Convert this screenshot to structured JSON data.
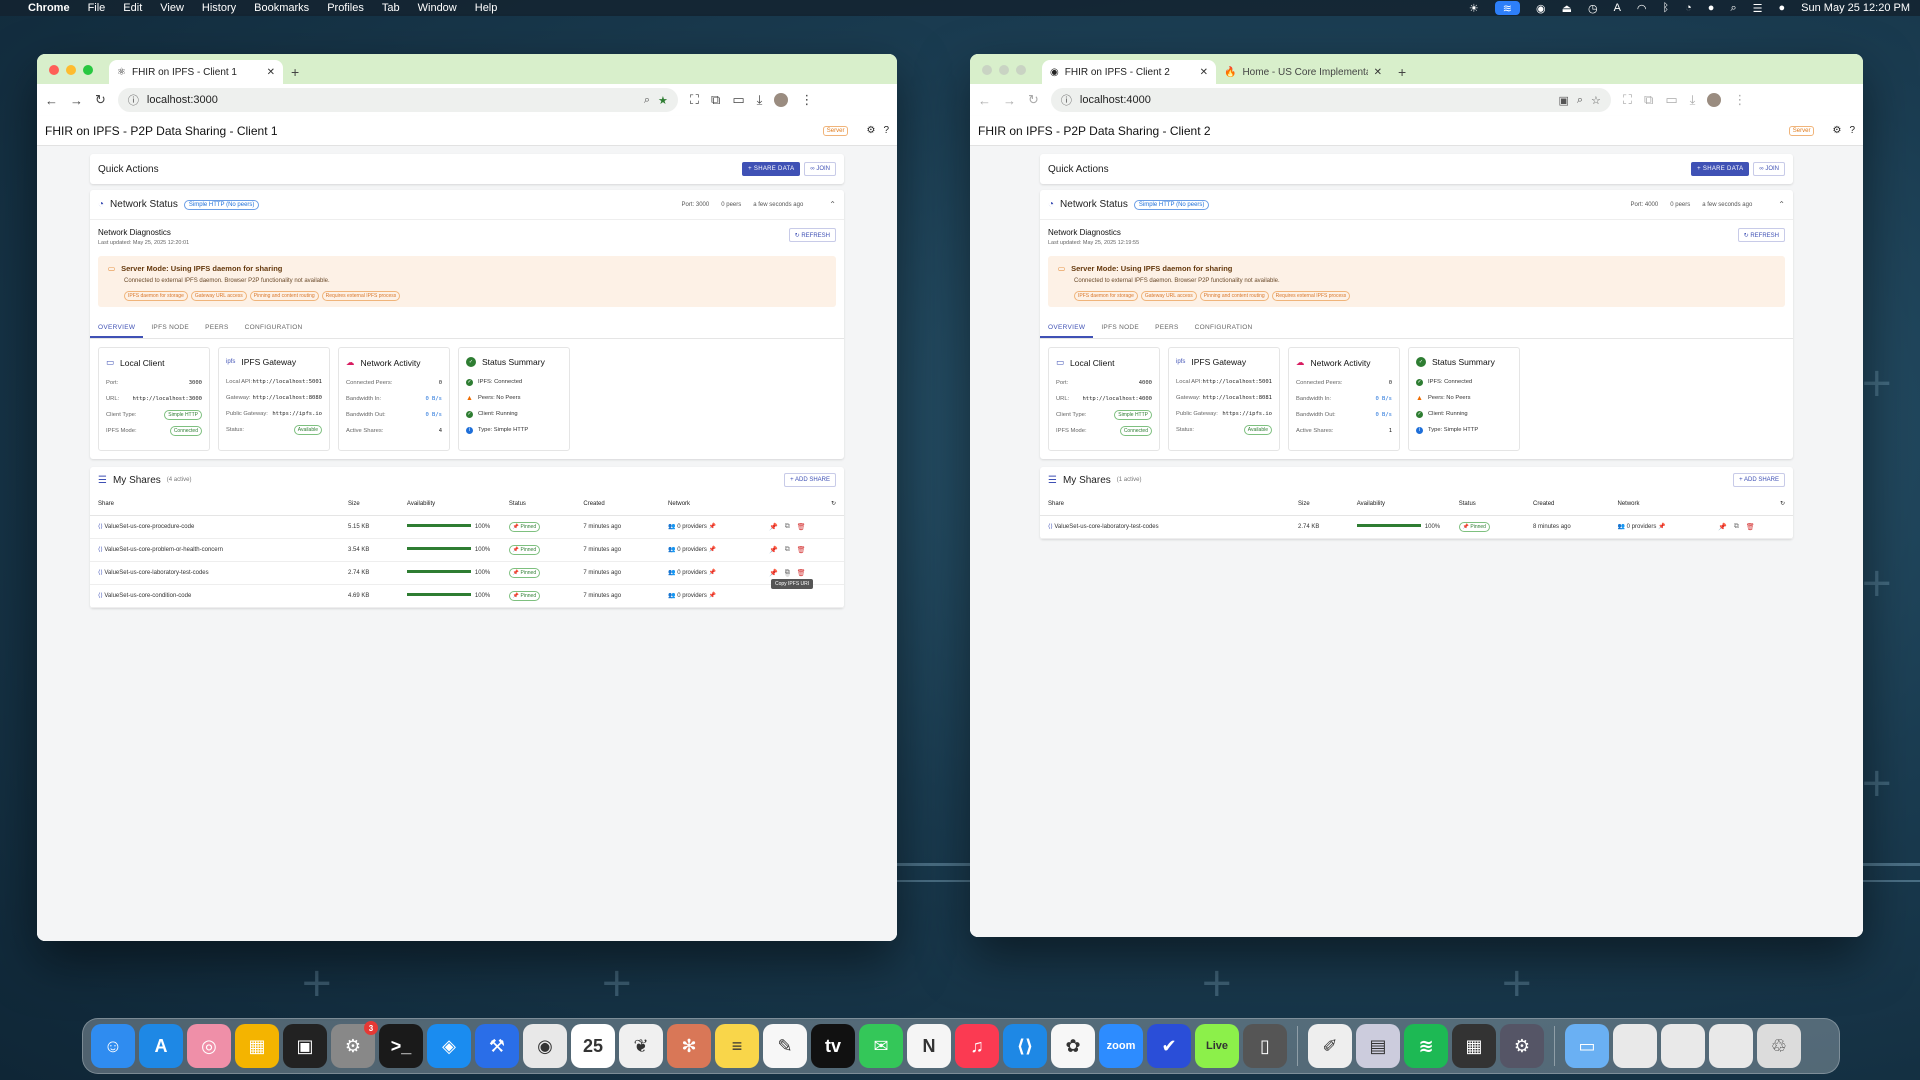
{
  "menubar": {
    "app": "Chrome",
    "items": [
      "File",
      "Edit",
      "View",
      "History",
      "Bookmarks",
      "Profiles",
      "Tab",
      "Window",
      "Help"
    ],
    "clock": "Sun May 25  12:20 PM"
  },
  "windows": [
    {
      "tabs": [
        {
          "title": "FHIR on IPFS - Client 1"
        }
      ],
      "url": "localhost:3000",
      "app_title": "FHIR on IPFS - P2P Data Sharing - Client 1",
      "server_badge": "Server",
      "quick_actions": {
        "title": "Quick Actions",
        "share_label": "SHARE DATA",
        "join_label": "JOIN"
      },
      "network_status": {
        "title": "Network Status",
        "mode_chip": "Simple HTTP (No peers)",
        "port": "Port: 3000",
        "peers": "0 peers",
        "updated": "a few seconds ago"
      },
      "diagnostics": {
        "title": "Network Diagnostics",
        "last_updated": "Last updated: May 25, 2025 12:20:01",
        "refresh_label": "REFRESH"
      },
      "alert": {
        "title": "Server Mode: Using IPFS daemon for sharing",
        "desc": "Connected to external IPFS daemon. Browser P2P functionality not available.",
        "chips": [
          "IPFS daemon for storage",
          "Gateway URL access",
          "Pinning and content routing",
          "Requires external IPFS process"
        ]
      },
      "nav_tabs": [
        "OVERVIEW",
        "IPFS NODE",
        "PEERS",
        "CONFIGURATION"
      ],
      "local_client": {
        "title": "Local Client",
        "port_label": "Port:",
        "port": "3000",
        "url_label": "URL:",
        "url": "http://localhost:3000",
        "type_label": "Client Type:",
        "type": "Simple HTTP",
        "mode_label": "IPFS Mode:",
        "mode": "Connected"
      },
      "gateway": {
        "title": "IPFS Gateway",
        "api_label": "Local API:",
        "api": "http://localhost:5001",
        "gw_label": "Gateway:",
        "gw": "http://localhost:8080",
        "pub_label": "Public Gateway:",
        "pub": "https://ipfs.io",
        "status_label": "Status:",
        "status": "Available"
      },
      "activity": {
        "title": "Network Activity",
        "peers_label": "Connected Peers:",
        "peers": "0",
        "in_label": "Bandwidth In:",
        "in": "0 B/s",
        "out_label": "Bandwidth Out:",
        "out": "0 B/s",
        "active_label": "Active Shares:",
        "active": "4"
      },
      "summary": {
        "title": "Status Summary",
        "items": [
          "IPFS: Connected",
          "Peers: No Peers",
          "Client: Running",
          "Type: Simple HTTP"
        ]
      },
      "shares": {
        "title": "My Shares",
        "count": "(4 active)",
        "add_label": "ADD SHARE",
        "columns": [
          "Share",
          "Size",
          "Availability",
          "Status",
          "Created",
          "Network"
        ],
        "rows": [
          {
            "name": "ValueSet-us-core-procedure-code",
            "size": "5.15 KB",
            "avail": "100%",
            "status": "Pinned",
            "created": "7 minutes ago",
            "network": "0 providers"
          },
          {
            "name": "ValueSet-us-core-problem-or-health-concern",
            "size": "3.54 KB",
            "avail": "100%",
            "status": "Pinned",
            "created": "7 minutes ago",
            "network": "0 providers"
          },
          {
            "name": "ValueSet-us-core-laboratory-test-codes",
            "size": "2.74 KB",
            "avail": "100%",
            "status": "Pinned",
            "created": "7 minutes ago",
            "network": "0 providers"
          },
          {
            "name": "ValueSet-us-core-condition-code",
            "size": "4.69 KB",
            "avail": "100%",
            "status": "Pinned",
            "created": "7 minutes ago",
            "network": "0 providers"
          }
        ],
        "tooltip": "Copy IPFS URI"
      }
    },
    {
      "tabs": [
        {
          "title": "FHIR on IPFS - Client 2"
        },
        {
          "title": "Home - US Core Implementat"
        }
      ],
      "url": "localhost:4000",
      "app_title": "FHIR on IPFS - P2P Data Sharing - Client 2",
      "server_badge": "Server",
      "quick_actions": {
        "title": "Quick Actions",
        "share_label": "SHARE DATA",
        "join_label": "JOIN"
      },
      "network_status": {
        "title": "Network Status",
        "mode_chip": "Simple HTTP (No peers)",
        "port": "Port: 4000",
        "peers": "0 peers",
        "updated": "a few seconds ago"
      },
      "diagnostics": {
        "title": "Network Diagnostics",
        "last_updated": "Last updated: May 25, 2025 12:19:55",
        "refresh_label": "REFRESH"
      },
      "alert": {
        "title": "Server Mode: Using IPFS daemon for sharing",
        "desc": "Connected to external IPFS daemon. Browser P2P functionality not available.",
        "chips": [
          "IPFS daemon for storage",
          "Gateway URL access",
          "Pinning and content routing",
          "Requires external IPFS process"
        ]
      },
      "nav_tabs": [
        "OVERVIEW",
        "IPFS NODE",
        "PEERS",
        "CONFIGURATION"
      ],
      "local_client": {
        "title": "Local Client",
        "port_label": "Port:",
        "port": "4000",
        "url_label": "URL:",
        "url": "http://localhost:4000",
        "type_label": "Client Type:",
        "type": "Simple HTTP",
        "mode_label": "IPFS Mode:",
        "mode": "Connected"
      },
      "gateway": {
        "title": "IPFS Gateway",
        "api_label": "Local API:",
        "api": "http://localhost:5001",
        "gw_label": "Gateway:",
        "gw": "http://localhost:8081",
        "pub_label": "Public Gateway:",
        "pub": "https://ipfs.io",
        "status_label": "Status:",
        "status": "Available"
      },
      "activity": {
        "title": "Network Activity",
        "peers_label": "Connected Peers:",
        "peers": "0",
        "in_label": "Bandwidth In:",
        "in": "0 B/s",
        "out_label": "Bandwidth Out:",
        "out": "0 B/s",
        "active_label": "Active Shares:",
        "active": "1"
      },
      "summary": {
        "title": "Status Summary",
        "items": [
          "IPFS: Connected",
          "Peers: No Peers",
          "Client: Running",
          "Type: Simple HTTP"
        ]
      },
      "shares": {
        "title": "My Shares",
        "count": "(1 active)",
        "add_label": "ADD SHARE",
        "columns": [
          "Share",
          "Size",
          "Availability",
          "Status",
          "Created",
          "Network"
        ],
        "rows": [
          {
            "name": "ValueSet-us-core-laboratory-test-codes",
            "size": "2.74 KB",
            "avail": "100%",
            "status": "Pinned",
            "created": "8 minutes ago",
            "network": "0 providers"
          }
        ]
      }
    }
  ],
  "dock": {
    "apps": [
      {
        "name": "finder",
        "label": "☺",
        "color": "#2f8cf0"
      },
      {
        "name": "app-store",
        "label": "A",
        "color": "#1e88e5"
      },
      {
        "name": "launchpad",
        "label": "◎",
        "color": "#ef8fa8"
      },
      {
        "name": "apps-grid",
        "label": "▦",
        "color": "#f4b400"
      },
      {
        "name": "mission-control",
        "label": "▣",
        "color": "#222"
      },
      {
        "name": "system-settings",
        "label": "⚙",
        "color": "#888",
        "badge": "3"
      },
      {
        "name": "terminal",
        "label": ">_",
        "color": "#1a1a1a"
      },
      {
        "name": "safari",
        "label": "◈",
        "color": "#1a8cf0"
      },
      {
        "name": "xcode",
        "label": "⚒",
        "color": "#2a6ee8"
      },
      {
        "name": "chrome",
        "label": "◉",
        "color": "#e8e8e8"
      },
      {
        "name": "calendar",
        "label": "25",
        "color": "#ffffff"
      },
      {
        "name": "mongodb",
        "label": "❦",
        "color": "#f0f0f0"
      },
      {
        "name": "claude",
        "label": "✻",
        "color": "#d97757"
      },
      {
        "name": "notes",
        "label": "≡",
        "color": "#f9d64a"
      },
      {
        "name": "freeform",
        "label": "✎",
        "color": "#f7f7f7"
      },
      {
        "name": "apple-tv",
        "label": "tv",
        "color": "#111"
      },
      {
        "name": "messages",
        "label": "✉",
        "color": "#34c759"
      },
      {
        "name": "news",
        "label": "N",
        "color": "#f5f5f5"
      },
      {
        "name": "music",
        "label": "♫",
        "color": "#fb3a52"
      },
      {
        "name": "vscode",
        "label": "⟨⟩",
        "color": "#1e88e5"
      },
      {
        "name": "photos",
        "label": "✿",
        "color": "#f7f7f7"
      },
      {
        "name": "zoom",
        "label": "zoom",
        "color": "#2d8cff"
      },
      {
        "name": "tasks",
        "label": "✔",
        "color": "#2a4ed8"
      },
      {
        "name": "live",
        "label": "Live",
        "color": "#8cf04a"
      },
      {
        "name": "iphone-mirroring",
        "label": "▯",
        "color": "#555"
      },
      {
        "name": "textedit",
        "label": "✐",
        "color": "#eee"
      },
      {
        "name": "preview",
        "label": "▤",
        "color": "#ccd"
      },
      {
        "name": "spotify",
        "label": "≋",
        "color": "#1db954"
      },
      {
        "name": "calculator",
        "label": "▦",
        "color": "#333"
      },
      {
        "name": "disk-utility",
        "label": "⚙",
        "color": "#556"
      },
      {
        "name": "downloads",
        "label": "▭",
        "color": "#6ab0f3"
      },
      {
        "name": "window-1",
        "label": "",
        "color": "#e9e9e9"
      },
      {
        "name": "window-2",
        "label": "",
        "color": "#e9e9e9"
      },
      {
        "name": "window-3",
        "label": "",
        "color": "#e9e9e9"
      },
      {
        "name": "trash",
        "label": "♲",
        "color": "#dcdcdc"
      }
    ]
  }
}
